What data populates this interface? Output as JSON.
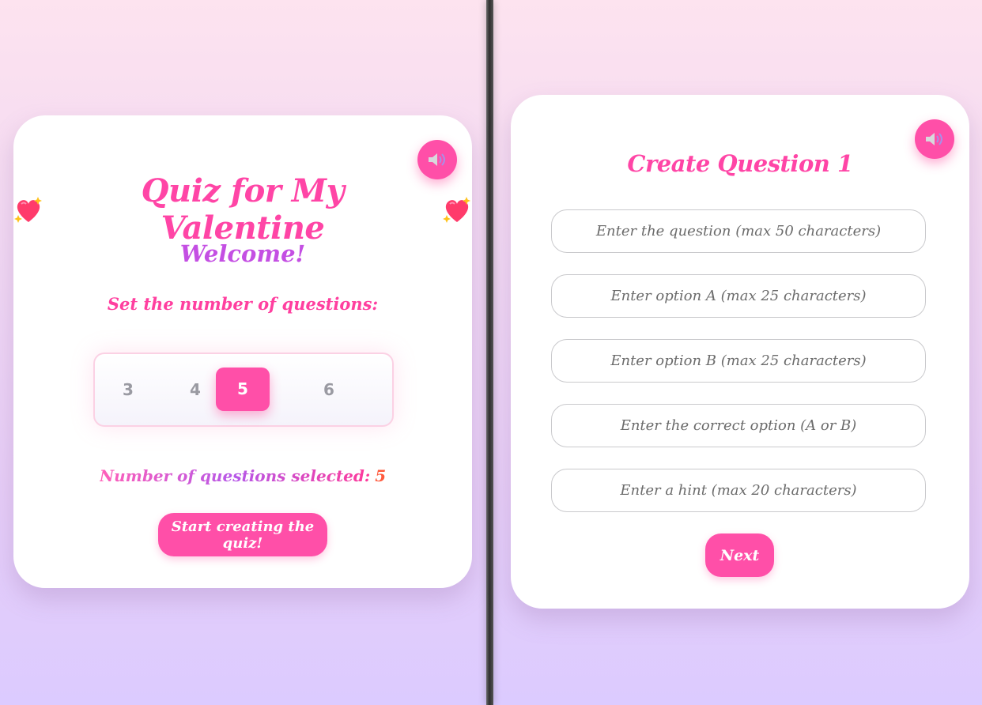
{
  "left_panel": {
    "title": "Quiz for My Valentine",
    "welcome": "Welcome!",
    "set_label": "Set the number of questions:",
    "options": [
      "3",
      "4",
      "5",
      "6"
    ],
    "selected_option": "5",
    "count_label": "Number of questions selected:",
    "count_value": "5",
    "start_button": "Start creating the quiz!",
    "sound_icon": "speaker-icon",
    "heart_icon": "sparkling-heart-icon"
  },
  "right_panel": {
    "title": "Create Question 1",
    "fields": {
      "question_placeholder": "Enter the question (max 50 characters)",
      "option_a_placeholder": "Enter option A (max 25 characters)",
      "option_b_placeholder": "Enter option B (max 25 characters)",
      "correct_placeholder": "Enter the correct option (A or B)",
      "hint_placeholder": "Enter a hint (max 20 characters)"
    },
    "next_button": "Next",
    "sound_icon": "speaker-icon"
  },
  "colors": {
    "accent": "#ff4fa8",
    "welcome": "#c44fe3",
    "count_value": "#ff5a3d"
  }
}
